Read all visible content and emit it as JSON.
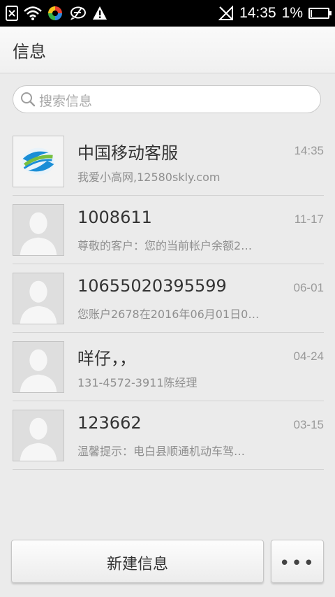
{
  "status_bar": {
    "left_icons": [
      "sim-missing-icon",
      "wifi-icon",
      "app-color-icon",
      "app-bubble-icon",
      "warning-icon"
    ],
    "right_icons": [
      "signal-off-icon",
      "battery-icon"
    ],
    "time": "14:35",
    "battery_percent": "1%",
    "battery_level": 0.01
  },
  "header": {
    "title": "信息"
  },
  "search": {
    "placeholder": "搜索信息"
  },
  "conversations": [
    {
      "name": "中国移动客服",
      "time": "14:35",
      "preview": "我爱小高网,12580skly.com",
      "avatar": "china-mobile-logo"
    },
    {
      "name": "1008611",
      "time": "11-17",
      "preview": "尊敬的客户：您的当前帐户余额2…",
      "avatar": "default-contact"
    },
    {
      "name": "10655020395599",
      "time": "06-01",
      "preview": "您账户2678在2016年06月01日0…",
      "avatar": "default-contact"
    },
    {
      "name": "咩仔，，",
      "time": "04-24",
      "preview": "131-4572-3911陈经理",
      "avatar": "default-contact"
    },
    {
      "name": "123662",
      "time": "03-15",
      "preview": "温馨提示：电白县顺通机动车驾…",
      "avatar": "default-contact"
    }
  ],
  "actions": {
    "new_message": "新建信息",
    "more": "•••"
  }
}
